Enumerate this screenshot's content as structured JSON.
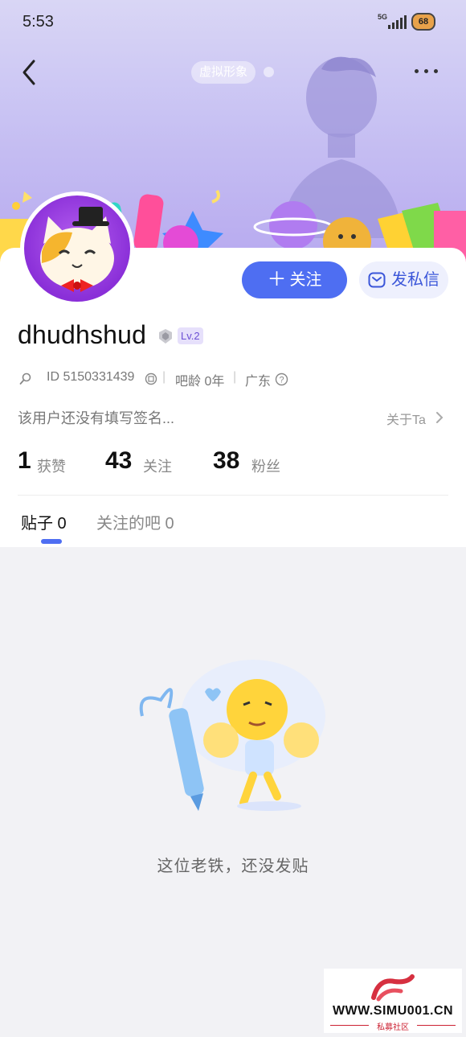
{
  "status_bar": {
    "time": "5:53",
    "network": "5G",
    "battery": "68"
  },
  "header": {
    "virtual_avatar_label": "虚拟形象"
  },
  "profile": {
    "username": "dhudhshud",
    "level": "Lv.2",
    "id_text": "ID 5150331439",
    "bar_age": "吧龄 0年",
    "location": "广东",
    "signature": "该用户还没有填写签名...",
    "about_label": "关于Ta"
  },
  "actions": {
    "follow_label": "关注",
    "message_label": "发私信"
  },
  "stats": [
    {
      "value": "1",
      "label": "获赞"
    },
    {
      "value": "43",
      "label": "关注"
    },
    {
      "value": "38",
      "label": "粉丝"
    }
  ],
  "tabs": [
    {
      "label": "贴子 0",
      "active": true
    },
    {
      "label": "关注的吧 0",
      "active": false
    }
  ],
  "empty_state": {
    "message": "这位老铁，还没发贴"
  },
  "watermark": {
    "url": "WWW.SIMU001.CN",
    "sub": "私募社区"
  },
  "colors": {
    "accent": "#4e6ef2",
    "hero_bg": "#c8c2f3",
    "page_bg": "#f2f2f5",
    "level_badge": "#6c4fd4"
  }
}
